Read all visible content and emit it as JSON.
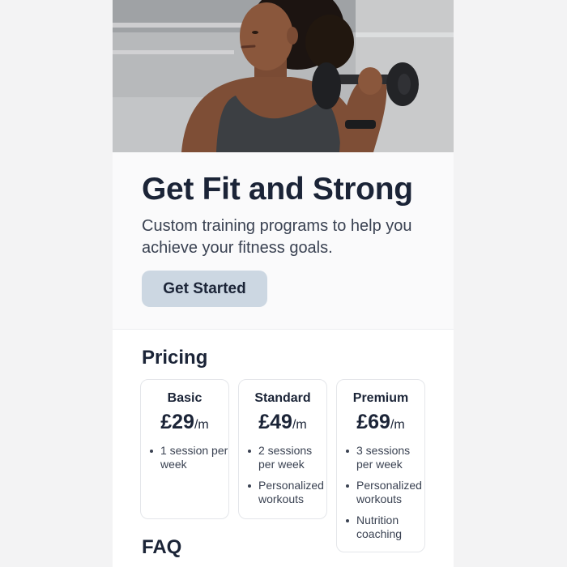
{
  "hero": {
    "image_alt": "Woman lifting a dumbbell outdoors",
    "title": "Get Fit and Strong",
    "subtitle": "Custom training programs to help you achieve your fitness goals.",
    "cta_label": "Get Started"
  },
  "pricing": {
    "heading": "Pricing",
    "plans": [
      {
        "name": "Basic",
        "price": "£29",
        "unit": "/m",
        "features": [
          "1 session per week"
        ]
      },
      {
        "name": "Standard",
        "price": "£49",
        "unit": "/m",
        "features": [
          "2 sessions per week",
          "Personalized workouts"
        ]
      },
      {
        "name": "Premium",
        "price": "£69",
        "unit": "/m",
        "features": [
          "3 sessions per week",
          "Personalized workouts",
          "Nutrition coaching"
        ]
      }
    ]
  },
  "faq": {
    "heading": "FAQ"
  },
  "colors": {
    "page_background": "#f3f3f4",
    "card_background": "#ffffff",
    "text_primary": "#1b2437",
    "text_secondary": "#3a4252",
    "cta_background": "#ccd7e2"
  }
}
